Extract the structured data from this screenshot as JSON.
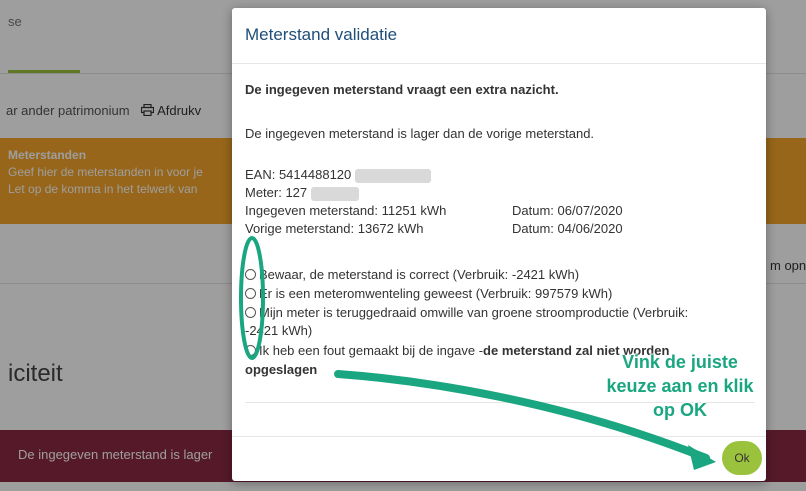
{
  "background": {
    "tab_label": "se",
    "actions_text": "ar ander patrimonium",
    "print_label": "Afdrukv",
    "warning": {
      "title": "Meterstanden",
      "line1": "Geef hier de meterstanden in voor je",
      "line2": "Let op de komma in het telwerk van"
    },
    "right_text": "m opn",
    "heading": "iciteit",
    "error_text": "De ingegeven meterstand is lager"
  },
  "modal": {
    "title": "Meterstand validatie",
    "notice": "De ingegeven meterstand vraagt een extra nazicht.",
    "message": "De ingegeven meterstand is lager dan de vorige meterstand.",
    "ean_label": "EAN: 5414488120",
    "meter_label": "Meter: 127",
    "entered_reading": "Ingegeven meterstand: 11251 kWh",
    "entered_date": "Datum: 06/07/2020",
    "previous_reading": "Vorige meterstand: 13672 kWh",
    "previous_date": "Datum: 04/06/2020",
    "options": [
      "Bewaar, de meterstand is correct (Verbruik: -2421 kWh)",
      "Er is een meteromwenteling geweest (Verbruik: 997579 kWh)",
      "Mijn meter is teruggedraaid omwille van groene stroomproductie (Verbruik:",
      "-2421 kWh)",
      "Ik heb een fout gemaakt bij de ingave - ",
      "de meterstand zal niet worden",
      "opgeslagen"
    ],
    "ok_label": "Ok"
  },
  "annotation": {
    "line1": "Vink de juiste",
    "line2": "keuze aan en klik",
    "line3": "op OK",
    "color": "#1aa680"
  },
  "colors": {
    "accent_green": "#9bc23c",
    "warning_orange": "#f4a52a",
    "error_red": "#8a2945",
    "title_blue": "#1f4e79"
  }
}
